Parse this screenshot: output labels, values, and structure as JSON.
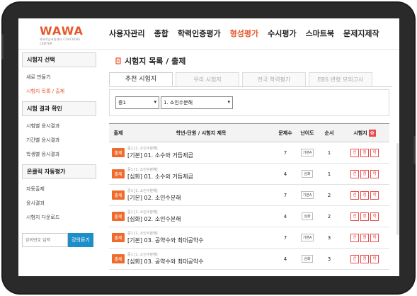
{
  "brand": {
    "logo_text": "WAWA",
    "logo_sub": "와와학습코칭센터 COACHING CENTER"
  },
  "nav": [
    {
      "label": "사용자관리",
      "active": false
    },
    {
      "label": "종합",
      "active": false
    },
    {
      "label": "학력인증평가",
      "active": false
    },
    {
      "label": "형성평가",
      "active": true
    },
    {
      "label": "수시평가",
      "active": false
    },
    {
      "label": "스마트북",
      "active": false
    },
    {
      "label": "문제지제작",
      "active": false
    }
  ],
  "sidebar": {
    "sections": [
      {
        "title": "시험지 선택",
        "items": [
          {
            "label": "새로 만들기",
            "active": false
          },
          {
            "label": "시험지 목록 / 출제",
            "active": true
          }
        ]
      },
      {
        "title": "시험 결과 확인",
        "items": [
          {
            "label": "시험별 응시결과",
            "active": false
          },
          {
            "label": "기간별 응시결과",
            "active": false
          },
          {
            "label": "학생별 응시결과",
            "active": false
          }
        ]
      },
      {
        "title": "온클릭 자동평가",
        "items": [
          {
            "label": "자동출제",
            "active": false
          },
          {
            "label": "응시결과",
            "active": false
          },
          {
            "label": "시험지 다운로드",
            "active": false
          }
        ]
      }
    ],
    "search_placeholder": "강의번호 입력",
    "search_button": "강의듣기"
  },
  "page_title": "시험지 목록 / 출제",
  "tabs": [
    {
      "label": "추천 시험지",
      "active": true
    },
    {
      "label": "우리 시험지",
      "active": false
    },
    {
      "label": "전국 학력평가",
      "active": false
    },
    {
      "label": "EBS 변형 모의고사",
      "active": false
    }
  ],
  "filters": {
    "grade": "중1",
    "unit": "1. 소인수분해"
  },
  "table": {
    "headers": [
      "출제",
      "학년-단원 / 시험지 제목",
      "문제수",
      "난이도",
      "순서",
      "시험지"
    ],
    "rows": [
      {
        "action": "출제",
        "unit": "중1 [1. 소인수분해]",
        "title": "[기본] 01. 소수와 거듭제곱",
        "count": "7",
        "difficulty": "기본A",
        "order": "1",
        "buttons": [
          "선",
          "정",
          "학"
        ]
      },
      {
        "action": "출제",
        "unit": "중1 [1. 소인수분해]",
        "title": "[심화] 01. 소수와 거듭제곱",
        "count": "4",
        "difficulty": "심화",
        "order": "1",
        "buttons": [
          "선",
          "정",
          "학"
        ]
      },
      {
        "action": "출제",
        "unit": "중1 [1. 소인수분해]",
        "title": "[기본] 02. 소인수분해",
        "count": "7",
        "difficulty": "기본A",
        "order": "2",
        "buttons": [
          "선",
          "정",
          "학"
        ]
      },
      {
        "action": "출제",
        "unit": "중1 [1. 소인수분해]",
        "title": "[심화] 02. 소인수분해",
        "count": "4",
        "difficulty": "심화",
        "order": "2",
        "buttons": [
          "선",
          "정",
          "학"
        ]
      },
      {
        "action": "출제",
        "unit": "중1 [1. 소인수분해]",
        "title": "[기본] 03. 공약수와 최대공약수",
        "count": "7",
        "difficulty": "기본A",
        "order": "3",
        "buttons": [
          "선",
          "정",
          "학"
        ]
      },
      {
        "action": "출제",
        "unit": "중1 [1. 소인수분해]",
        "title": "[심화] 03. 공약수와 최대공약수",
        "count": "4",
        "difficulty": "심화",
        "order": "3",
        "buttons": [
          "선",
          "정",
          "학"
        ]
      }
    ]
  },
  "colors": {
    "accent": "#e8572a",
    "button_orange": "#f06a2c",
    "exam_red": "#e84c4c",
    "search_blue": "#1e8ec9"
  }
}
